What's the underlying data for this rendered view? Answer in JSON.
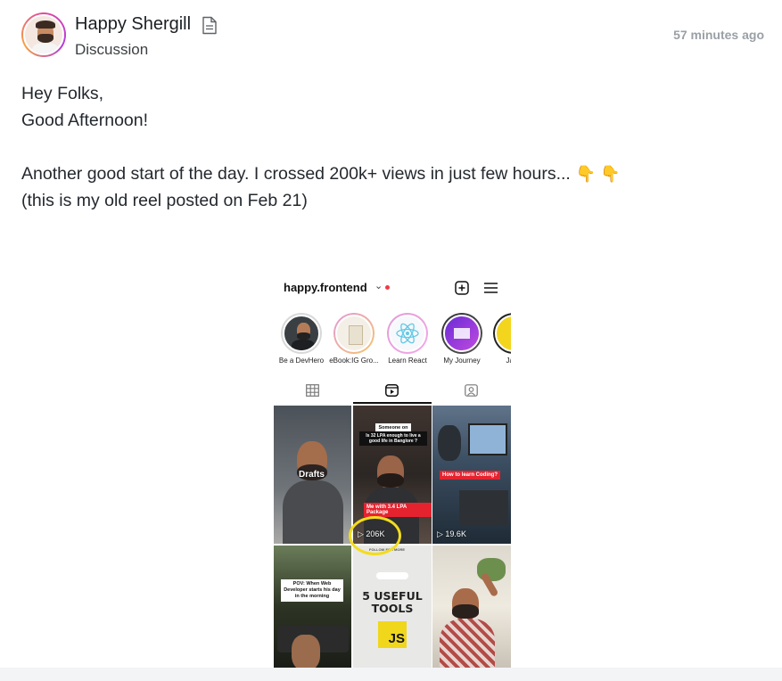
{
  "post": {
    "author": "Happy Shergill",
    "type": "Discussion",
    "timestamp": "57 minutes ago",
    "lines": [
      "Hey Folks,",
      "Good Afternoon!",
      "Another good start of the day. I crossed 200k+ views in just few hours...",
      "(this is my old reel posted on Feb 21)"
    ],
    "emoji": "👇 👇"
  },
  "instagram": {
    "username": "happy.frontend",
    "caret": "⌄",
    "stories": [
      {
        "label": "Be a DevHero"
      },
      {
        "label": "eBook:IG Gro..."
      },
      {
        "label": "Learn React"
      },
      {
        "label": "My Journey"
      },
      {
        "label": "Java"
      }
    ],
    "tiles": {
      "drafts_label": "Drafts",
      "tile2_top": "Someone on Quora",
      "tile2_question": "Is 32 LPA enough to live a good life in Banglore ?",
      "tile2_bottom": "Me with 3.4 LPA Package",
      "tile2_views": "▷ 206K",
      "tile3_caption": "How to learn Coding?",
      "tile3_views": "▷ 19.6K",
      "tile4_caption": "POV: When Web Developer starts his day in the morning",
      "tile5_small": "FOLLOW FOR MORE",
      "tile5_title": "5 USEFUL TOOLS",
      "tile5_badge": "JS"
    }
  },
  "colors": {
    "highlight_circle": "#f3dc1e",
    "ig_notification_dot": "#ed3b4b",
    "timestamp": "#9aa0a6"
  }
}
